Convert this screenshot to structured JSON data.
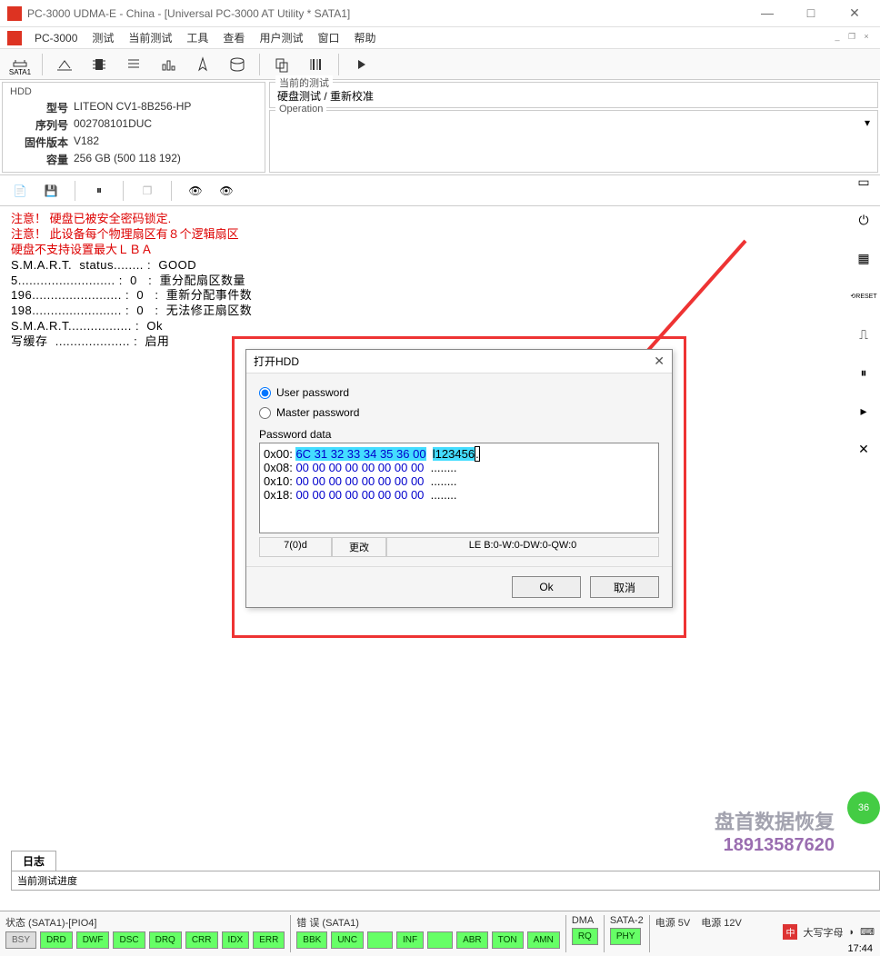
{
  "window": {
    "title": "PC-3000 UDMA-E - China - [Universal PC-3000 AT Utility * SATA1]"
  },
  "menu": {
    "app": "PC-3000",
    "items": [
      "测试",
      "当前测试",
      "工具",
      "查看",
      "用户测试",
      "窗口",
      "帮助"
    ]
  },
  "toolbar": {
    "sata_label": "SATA1"
  },
  "hdd": {
    "title": "HDD",
    "model_label": "型号",
    "model": "LITEON CV1-8B256-HP",
    "serial_label": "序列号",
    "serial": "002708101DUC",
    "firmware_label": "固件版本",
    "firmware": "V182",
    "capacity_label": "容量",
    "capacity": "256 GB (500 118 192)"
  },
  "current_test": {
    "legend": "当前的测试",
    "content": "硬盘测试 / 重新校准"
  },
  "operation": {
    "legend": "Operation"
  },
  "log": {
    "warn1": "注意！  硬盘已被安全密码锁定.",
    "warn2": "注意！  此设备每个物理扇区有８个逻辑扇区",
    "warn3": "硬盘不支持设置最大ＬＢＡ",
    "line1": "S.M.A.R.T.  status........ :  GOOD",
    "line2": "5.......................... :  0   :  重分配扇区数量",
    "line3": "196........................ :  0   :  重新分配事件数",
    "line4": "198........................ :  0   :  无法修正扇区数",
    "line5": "S.M.A.R.T................. :  Ok",
    "line6": "写缓存  .................... :  启用"
  },
  "dialog": {
    "title": "打开HDD",
    "radio_user": "User password",
    "radio_master": "Master password",
    "pwd_label": "Password data",
    "hex": [
      {
        "addr": "0x00:",
        "bytes": "6C 31 32 33 34 35 36 00",
        "ascii": "l123456.",
        "hl": true
      },
      {
        "addr": "0x08:",
        "bytes": "00 00 00 00 00 00 00 00",
        "ascii": "........",
        "hl": false
      },
      {
        "addr": "0x10:",
        "bytes": "00 00 00 00 00 00 00 00",
        "ascii": "........",
        "hl": false
      },
      {
        "addr": "0x18:",
        "bytes": "00 00 00 00 00 00 00 00",
        "ascii": "........",
        "hl": false
      }
    ],
    "status_left": "7(0)d",
    "status_mid": "更改",
    "status_right": "LE B:0-W:0-DW:0-QW:0",
    "ok": "Ok",
    "cancel": "取消"
  },
  "right_labels": {
    "reset": "RESET"
  },
  "watermark": {
    "line1": "盘首数据恢复",
    "line2": "18913587620"
  },
  "green_badge": "36",
  "tabs": {
    "log_tab": "日志",
    "progress": "当前测试进度"
  },
  "status": {
    "sata_title": "状态 (SATA1)-[PIO4]",
    "sata_inds": [
      "BSY",
      "DRD",
      "DWF",
      "DSC",
      "DRQ",
      "CRR",
      "IDX",
      "ERR"
    ],
    "err_title": "错 误 (SATA1)",
    "err_inds": [
      "BBK",
      "UNC",
      "",
      "INF",
      "",
      "ABR",
      "TON",
      "AMN"
    ],
    "dma_title": "DMA",
    "dma_inds": [
      "RQ"
    ],
    "sata2_title": "SATA-2",
    "sata2_inds": [
      "PHY"
    ],
    "pwr5_title": "电源 5V",
    "pwr12_title": "电源 12V"
  },
  "tray": {
    "ime": "大写字母",
    "time": "17:44"
  }
}
